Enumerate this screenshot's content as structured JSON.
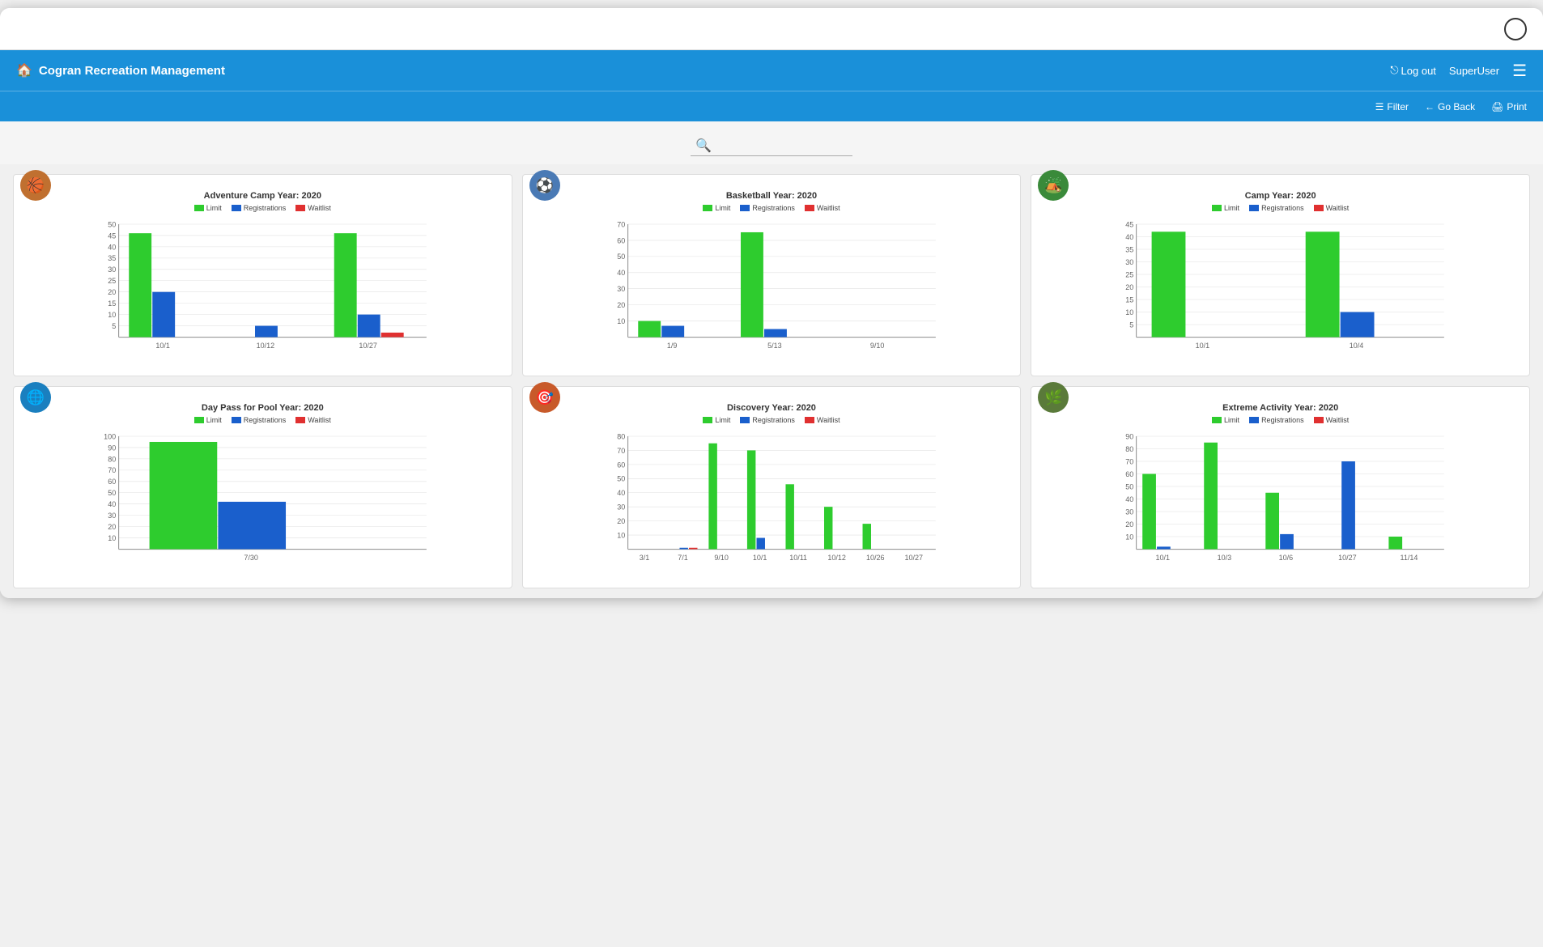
{
  "app": {
    "title": "Cogran Recreation Management",
    "user": "SuperUser",
    "logout_label": "Log out",
    "goback_label": "Go Back",
    "print_label": "Print",
    "filter_label": "Filter"
  },
  "search": {
    "placeholder": ""
  },
  "charts": [
    {
      "id": "adventure-camp",
      "title": "Adventure Camp Year: 2020",
      "avatar_color": "#c85a2a",
      "xLabels": [
        "10/1",
        "10/12",
        "10/27"
      ],
      "yMax": 50,
      "yTicks": [
        0,
        5,
        10,
        15,
        20,
        25,
        30,
        35,
        40,
        45,
        50
      ],
      "bars": [
        {
          "x_group": 0,
          "label": "10/1",
          "limit": 46,
          "reg": 20,
          "wait": 0
        },
        {
          "x_group": 1,
          "label": "10/12",
          "limit": 0,
          "reg": 5,
          "wait": 0
        },
        {
          "x_group": 2,
          "label": "10/27",
          "limit": 46,
          "reg": 10,
          "wait": 2
        }
      ]
    },
    {
      "id": "basketball",
      "title": "Basketball Year: 2020",
      "avatar_color": "#4a7ab5",
      "xLabels": [
        "1/9",
        "5/13",
        "9/10"
      ],
      "yMax": 70,
      "yTicks": [
        0,
        10,
        20,
        30,
        40,
        50,
        60,
        70
      ],
      "bars": [
        {
          "x_group": 0,
          "label": "1/9",
          "limit": 10,
          "reg": 7,
          "wait": 0
        },
        {
          "x_group": 1,
          "label": "5/13",
          "limit": 65,
          "reg": 5,
          "wait": 0
        },
        {
          "x_group": 2,
          "label": "9/10",
          "limit": 0,
          "reg": 0,
          "wait": 0
        }
      ]
    },
    {
      "id": "camp",
      "title": "Camp Year: 2020",
      "avatar_color": "#3a8a3a",
      "xLabels": [
        "10/1",
        "10/4"
      ],
      "yMax": 45,
      "yTicks": [
        0,
        5,
        10,
        15,
        20,
        25,
        30,
        35,
        40,
        45
      ],
      "bars": [
        {
          "x_group": 0,
          "label": "10/1",
          "limit": 42,
          "reg": 0,
          "wait": 0
        },
        {
          "x_group": 1,
          "label": "10/4",
          "limit": 42,
          "reg": 10,
          "wait": 0
        }
      ]
    },
    {
      "id": "day-pass-pool",
      "title": "Day Pass for Pool Year: 2020",
      "avatar_color": "#1a7fbf",
      "xLabels": [
        "7/30"
      ],
      "yMax": 100,
      "yTicks": [
        0,
        10,
        20,
        30,
        40,
        50,
        60,
        70,
        80,
        90,
        100
      ],
      "bars": [
        {
          "x_group": 0,
          "label": "7/30",
          "limit": 95,
          "reg": 42,
          "wait": 0
        }
      ]
    },
    {
      "id": "discovery",
      "title": "Discovery Year: 2020",
      "avatar_color": "#c85a2a",
      "xLabels": [
        "3/1",
        "7/1",
        "9/10",
        "10/1",
        "10/11",
        "10/12",
        "10/26",
        "10/27"
      ],
      "yMax": 80,
      "yTicks": [
        0,
        10,
        20,
        30,
        40,
        50,
        60,
        70,
        80
      ],
      "bars": [
        {
          "x_group": 0,
          "label": "3/1",
          "limit": 0,
          "reg": 0,
          "wait": 0
        },
        {
          "x_group": 1,
          "label": "7/1",
          "limit": 0,
          "reg": 1,
          "wait": 1
        },
        {
          "x_group": 2,
          "label": "9/10",
          "limit": 75,
          "reg": 0,
          "wait": 0
        },
        {
          "x_group": 3,
          "label": "10/1",
          "limit": 70,
          "reg": 8,
          "wait": 0
        },
        {
          "x_group": 4,
          "label": "10/11",
          "limit": 46,
          "reg": 0,
          "wait": 0
        },
        {
          "x_group": 5,
          "label": "10/12",
          "limit": 30,
          "reg": 0,
          "wait": 0
        },
        {
          "x_group": 6,
          "label": "10/26",
          "limit": 18,
          "reg": 0,
          "wait": 0
        },
        {
          "x_group": 7,
          "label": "10/27",
          "limit": 0,
          "reg": 0,
          "wait": 0
        }
      ]
    },
    {
      "id": "extreme-activity",
      "title": "Extreme Activity  Year: 2020",
      "avatar_color": "#5a7a3a",
      "xLabels": [
        "10/1",
        "10/3",
        "10/6",
        "10/27",
        "11/14"
      ],
      "yMax": 90,
      "yTicks": [
        0,
        10,
        20,
        30,
        40,
        50,
        60,
        70,
        80,
        90
      ],
      "bars": [
        {
          "x_group": 0,
          "label": "10/1",
          "limit": 60,
          "reg": 2,
          "wait": 0
        },
        {
          "x_group": 1,
          "label": "10/3",
          "limit": 85,
          "reg": 0,
          "wait": 0
        },
        {
          "x_group": 2,
          "label": "10/6",
          "limit": 45,
          "reg": 12,
          "wait": 0
        },
        {
          "x_group": 3,
          "label": "10/27",
          "limit": 0,
          "reg": 70,
          "wait": 0
        },
        {
          "x_group": 4,
          "label": "11/14",
          "limit": 10,
          "reg": 0,
          "wait": 0
        }
      ]
    }
  ],
  "legend": {
    "limit": "Limit",
    "registrations": "Registrations",
    "waitlist": "Waitlist"
  },
  "colors": {
    "limit": "#2ecc2e",
    "registrations": "#1a5fcc",
    "waitlist": "#e03030",
    "nav": "#1a90d9"
  }
}
